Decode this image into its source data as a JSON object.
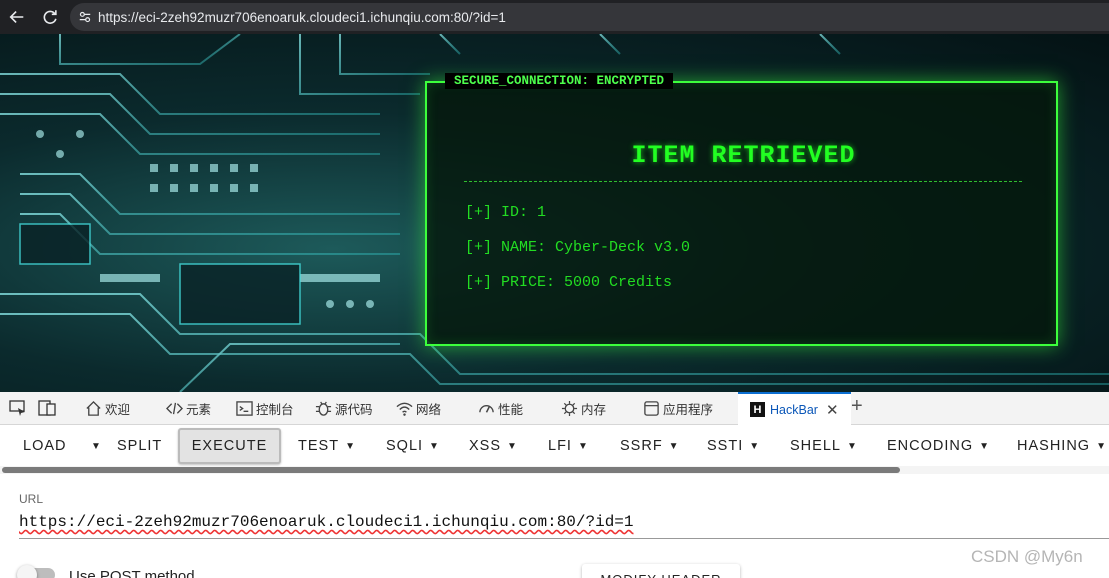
{
  "browser": {
    "url": "https://eci-2zeh92muzr706enoaruk.cloudeci1.ichunqiu.com:80/?id=1"
  },
  "terminal": {
    "tag": "SECURE_CONNECTION: ENCRYPTED",
    "title": "ITEM RETRIEVED",
    "lines": [
      "[+] ID: 1",
      "[+] NAME: Cyber-Deck v3.0",
      "[+] PRICE: 5000 Credits"
    ],
    "accent_color": "#22ff22"
  },
  "devtools": {
    "tabs": [
      {
        "label": "欢迎",
        "icon": "home-icon"
      },
      {
        "label": "元素",
        "icon": "code-icon"
      },
      {
        "label": "控制台",
        "icon": "console-icon"
      },
      {
        "label": "源代码",
        "icon": "bug-icon"
      },
      {
        "label": "网络",
        "icon": "wifi-icon"
      },
      {
        "label": "性能",
        "icon": "gauge-icon"
      },
      {
        "label": "内存",
        "icon": "memory-icon"
      },
      {
        "label": "应用程序",
        "icon": "application-icon"
      },
      {
        "label": "HackBar",
        "icon": "hackbar-logo-icon",
        "active": true
      }
    ]
  },
  "hackbar": {
    "buttons": {
      "load": "LOAD",
      "split": "SPLIT",
      "execute": "EXECUTE",
      "test": "TEST",
      "sqli": "SQLI",
      "xss": "XSS",
      "lfi": "LFI",
      "ssrf": "SSRF",
      "ssti": "SSTI",
      "shell": "SHELL",
      "encoding": "ENCODING",
      "hashing": "HASHING"
    },
    "url_label": "URL",
    "url_value": "https://eci-2zeh92muzr706enoaruk.cloudeci1.ichunqiu.com:80/?id=1",
    "post_label": "Use POST method",
    "modify_header": "MODIFY HEADER"
  },
  "watermark": "CSDN @My6n"
}
